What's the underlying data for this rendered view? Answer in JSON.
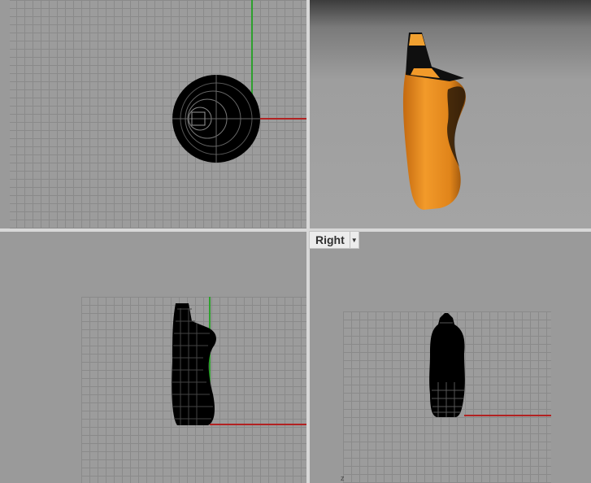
{
  "viewports": {
    "top": {
      "icon": "wireframe-top-view"
    },
    "perspective": {
      "icon": "rendered-bottle",
      "colors": {
        "body": "#e8891c",
        "cap": "#111111"
      }
    },
    "front": {
      "icon": "wireframe-front-view"
    },
    "right": {
      "tab_label": "Right",
      "menu_icon": "chevron-down-icon",
      "icon": "wireframe-right-view"
    }
  },
  "colors": {
    "x_axis": "#b22222",
    "y_axis": "#2ea02e",
    "grid": "#8a8a8a",
    "background": "#9c9c9c"
  }
}
